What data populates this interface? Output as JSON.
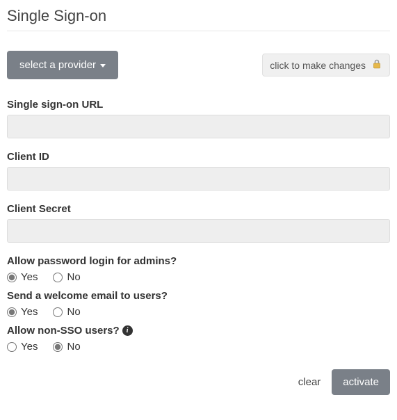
{
  "page": {
    "title": "Single Sign-on"
  },
  "top": {
    "provider_button_label": "select a provider",
    "lock_badge_text": "click to make changes"
  },
  "fields": {
    "sso_url": {
      "label": "Single sign-on URL",
      "value": ""
    },
    "client_id": {
      "label": "Client ID",
      "value": ""
    },
    "client_secret": {
      "label": "Client Secret",
      "value": ""
    }
  },
  "radios": {
    "admin_password": {
      "label": "Allow password login for admins?",
      "yes": "Yes",
      "no": "No",
      "selected": "yes"
    },
    "welcome_email": {
      "label": "Send a welcome email to users?",
      "yes": "Yes",
      "no": "No",
      "selected": "yes"
    },
    "non_sso": {
      "label": "Allow non-SSO users?",
      "yes": "Yes",
      "no": "No",
      "selected": "no"
    }
  },
  "footer": {
    "clear_label": "clear",
    "activate_label": "activate"
  }
}
